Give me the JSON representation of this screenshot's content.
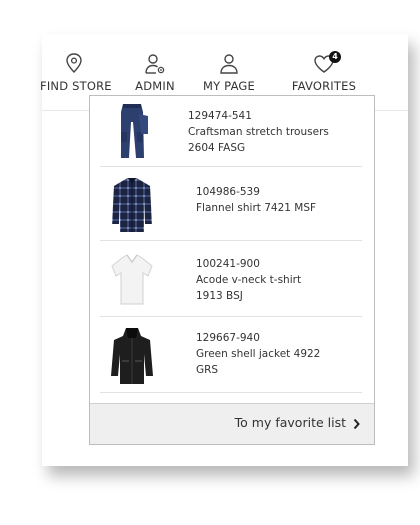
{
  "nav": {
    "items": [
      {
        "label": "FIND STORE",
        "icon": "location-pin-icon"
      },
      {
        "label": "ADMIN",
        "icon": "user-settings-icon"
      },
      {
        "label": "MY PAGE",
        "icon": "user-icon"
      },
      {
        "label": "FAVORITES",
        "icon": "heart-icon",
        "badge": "4"
      }
    ]
  },
  "favorites": {
    "items": [
      {
        "code": "129474-541",
        "name": "Craftsman stretch trousers",
        "detail": "2604 FASG",
        "image": "navy-trousers-image"
      },
      {
        "code": "104986-539",
        "name": "Flannel shirt 7421 MSF",
        "detail": "",
        "image": "checked-flannel-shirt-image"
      },
      {
        "code": "100241-900",
        "name": "Acode v-neck t-shirt",
        "detail": "1913 BSJ",
        "image": "white-tshirt-image"
      },
      {
        "code": "129667-940",
        "name": "Green shell jacket 4922",
        "detail": "GRS",
        "image": "black-shell-jacket-image"
      }
    ],
    "footer_label": "To my favorite list",
    "footer_icon": "chevron-right-icon"
  },
  "colors": {
    "text": "#333333",
    "badge": "#111111",
    "footer_bg": "#efefef",
    "border": "#bdbdbd"
  }
}
